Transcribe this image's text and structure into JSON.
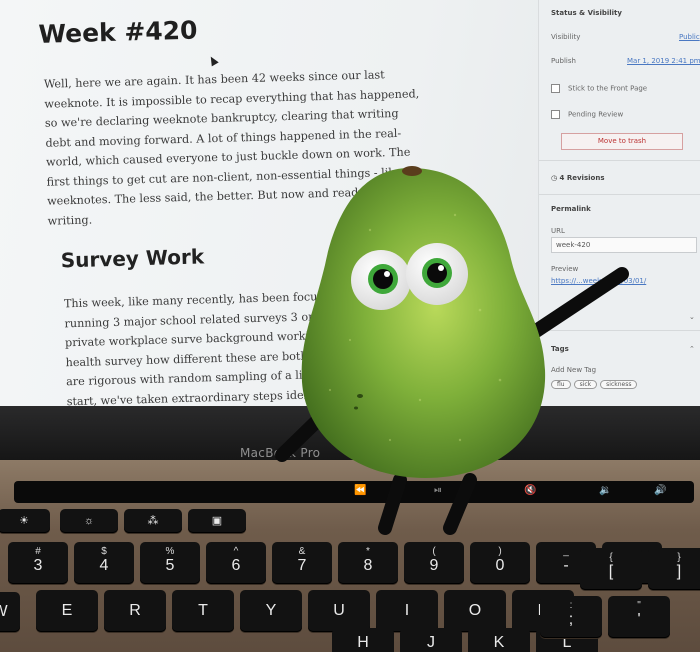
{
  "post": {
    "title": "Week #420",
    "paragraph1": "Well, here we are again. It has been 42 weeks since our last weeknote. It is impossible to recap everything that has happened, so we're declaring weeknote bankruptcy, clearing that writing debt and moving forward. A lot of things happened in the real-world, which caused everyone to just buckle down on work. The first things to get cut are non-client, non-essential things - like weeknotes. The less said, the better. But now and ready to get writing.",
    "heading": "Survey Work",
    "paragraph2": "This week, like many recently, has been focused on currently running 3 major school related surveys 3 or 4 next month, plus a private workplace surve background working on an online health survey how different these are both technically and soci are rigorous with random sampling of a list of no Once they start, we've taken extraordinary steps identifiable information. All the reporting is static"
  },
  "sidebar": {
    "section": "Status & Visibility",
    "visibility_label": "Visibility",
    "visibility_value": "Public",
    "publish_label": "Publish",
    "publish_value": "Mar 1, 2019 2:41 pm",
    "stick_label": "Stick to the Front Page",
    "pending_label": "Pending Review",
    "trash_label": "Move to trash",
    "revisions": "4 Revisions",
    "permalink_title": "Permalink",
    "url_label": "URL",
    "url_value": "week-420",
    "preview_label": "Preview",
    "preview_link": "https://...week/2019/03/01/",
    "tags_title": "Tags",
    "add_tag_label": "Add New Tag",
    "tags": [
      "flu",
      "sick",
      "sickness"
    ]
  },
  "laptop": {
    "brand": "MacBook Pro"
  },
  "keyboard": {
    "number_row": [
      {
        "top": "#",
        "main": "3"
      },
      {
        "top": "$",
        "main": "4"
      },
      {
        "top": "%",
        "main": "5"
      },
      {
        "top": "^",
        "main": "6"
      },
      {
        "top": "&",
        "main": "7"
      },
      {
        "top": "*",
        "main": "8"
      },
      {
        "top": "(",
        "main": "9"
      },
      {
        "top": ")",
        "main": "0"
      },
      {
        "top": "_",
        "main": "-"
      },
      {
        "top": "+",
        "main": "="
      }
    ],
    "letter_row1": [
      "W",
      "E",
      "R",
      "T",
      "Y",
      "U",
      "I",
      "O",
      "P"
    ],
    "bracket_keys": [
      {
        "top": "{",
        "main": "["
      },
      {
        "top": "}",
        "main": "]"
      }
    ],
    "letter_row2": [
      "H",
      "J",
      "K",
      "L"
    ],
    "punct_keys": [
      {
        "top": ":",
        "main": ";"
      },
      {
        "top": "\"",
        "main": "'"
      }
    ]
  },
  "colors": {
    "avocado_skin": "#6fa030",
    "avocado_highlight": "#b9d95a",
    "eye_iris": "#3fa83a",
    "screen_bg": "#f2f4f5",
    "deck": "#7c6856"
  }
}
